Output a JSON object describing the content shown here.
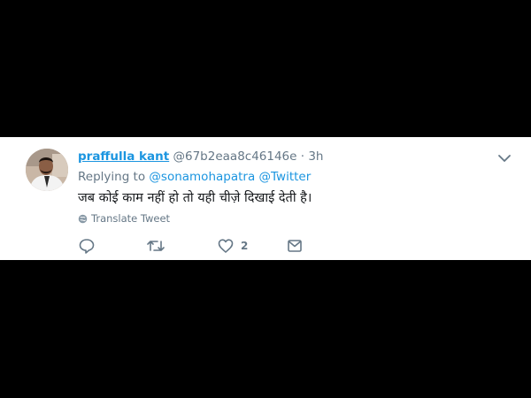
{
  "tweet": {
    "author_name": "praffulla kant",
    "handle": "@67b2eaa8c46146e",
    "separator": "·",
    "time": "3h",
    "replying_prefix": "Replying to",
    "replying_to": [
      "@sonamohapatra",
      "@Twitter"
    ],
    "text": "जब कोई काम नहीं हो तो यही चीज़े दिखाई देती है।",
    "translate_label": "Translate Tweet",
    "like_count": "2"
  },
  "icons": {
    "reply": "reply-icon",
    "retweet": "retweet-icon",
    "like": "heart-icon",
    "message": "envelope-icon",
    "more": "chevron-down-icon",
    "translate": "globe-icon"
  },
  "colors": {
    "background": "#000000",
    "card": "#ffffff",
    "link": "#1b95e0",
    "muted": "#657786",
    "text": "#14171a"
  }
}
